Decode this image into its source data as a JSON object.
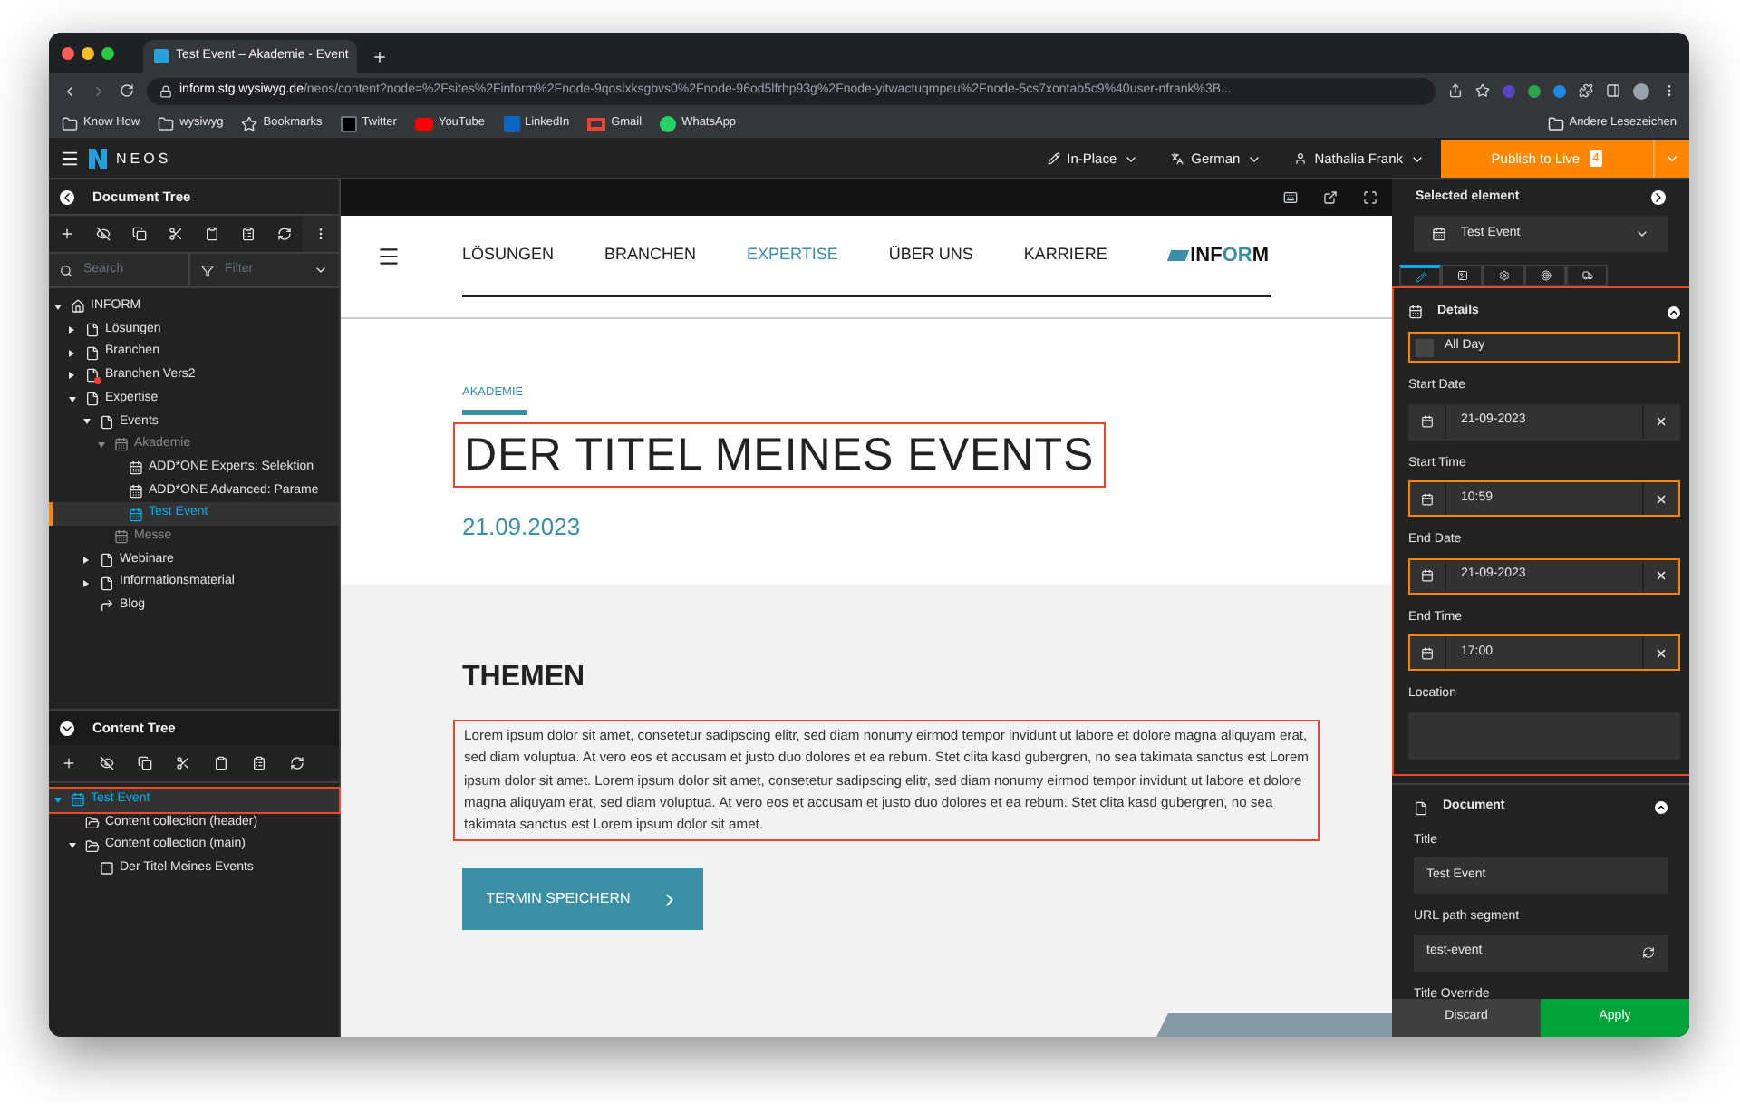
{
  "browser": {
    "tab_title": "Test Event – Akademie - Event",
    "url_host": "inform.stg.wysiwyg.de",
    "url_path": "/neos/content?node=%2Fsites%2Finform%2Fnode-9qoslxksgbvs0%2Fnode-96od5lfrhp93g%2Fnode-yitwactuqmpeu%2Fnode-5cs7xontab5c9%40user-nfrank%3B...",
    "bookmarks": [
      {
        "label": "Know How",
        "kind": "folder"
      },
      {
        "label": "wysiwyg",
        "kind": "folder"
      },
      {
        "label": "Bookmarks",
        "kind": "star"
      },
      {
        "label": "Twitter",
        "kind": "x"
      },
      {
        "label": "YouTube",
        "kind": "youtube"
      },
      {
        "label": "LinkedIn",
        "kind": "linkedin"
      },
      {
        "label": "Gmail",
        "kind": "gmail"
      },
      {
        "label": "WhatsApp",
        "kind": "whatsapp"
      }
    ],
    "other_bookmarks": "Andere Lesezeichen"
  },
  "topbar": {
    "logo": "NEOS",
    "edit_mode": "In-Place",
    "language": "German",
    "user": "Nathalia Frank",
    "publish": "Publish to Live",
    "publish_count": "4"
  },
  "document_tree": {
    "title": "Document Tree",
    "search_placeholder": "Search",
    "filter_placeholder": "Filter",
    "nodes": [
      {
        "label": "INFORM",
        "kind": "home",
        "expanded": true,
        "selected": false,
        "hidden": false,
        "children": [
          {
            "label": "Lösungen",
            "kind": "page",
            "expanded": false,
            "selected": false,
            "hidden": false
          },
          {
            "label": "Branchen",
            "kind": "page",
            "expanded": false,
            "selected": false,
            "hidden": false
          },
          {
            "label": "Branchen Vers2",
            "kind": "page-error",
            "expanded": false,
            "selected": false,
            "hidden": false
          },
          {
            "label": "Expertise",
            "kind": "page",
            "expanded": true,
            "selected": false,
            "hidden": false,
            "children": [
              {
                "label": "Events",
                "kind": "page",
                "expanded": true,
                "selected": false,
                "hidden": false,
                "children": [
                  {
                    "label": "Akademie",
                    "kind": "event",
                    "expanded": true,
                    "selected": false,
                    "hidden": true,
                    "children": [
                      {
                        "label": "ADD*ONE Experts: Selektion",
                        "kind": "event",
                        "selected": false,
                        "hidden": false
                      },
                      {
                        "label": "ADD*ONE Advanced: Parame",
                        "kind": "event",
                        "selected": false,
                        "hidden": false
                      },
                      {
                        "label": "Test Event",
                        "kind": "event",
                        "selected": true,
                        "hidden": false
                      }
                    ]
                  },
                  {
                    "label": "Messe",
                    "kind": "event",
                    "selected": false,
                    "hidden": true
                  }
                ]
              },
              {
                "label": "Webinare",
                "kind": "page",
                "expanded": false,
                "selected": false,
                "hidden": false
              },
              {
                "label": "Informationsmaterial",
                "kind": "page",
                "expanded": false,
                "selected": false,
                "hidden": false
              },
              {
                "label": "Blog",
                "kind": "shortcut",
                "selected": false,
                "hidden": false
              }
            ]
          }
        ]
      }
    ]
  },
  "content_tree": {
    "title": "Content Tree",
    "nodes": [
      {
        "label": "Test Event",
        "kind": "event",
        "expanded": true,
        "selected": true,
        "highlighted": true,
        "children": [
          {
            "label": "Content collection (header)",
            "kind": "collection",
            "selected": false,
            "highlighted": false
          },
          {
            "label": "Content collection (main)",
            "kind": "collection",
            "expanded": true,
            "selected": false,
            "highlighted": false,
            "children": [
              {
                "label": "Der Titel Meines Events",
                "kind": "content",
                "selected": false,
                "highlighted": false
              }
            ]
          }
        ]
      }
    ]
  },
  "page": {
    "nav": [
      {
        "label": "LÖSUNGEN",
        "selected": false
      },
      {
        "label": "BRANCHEN",
        "selected": false
      },
      {
        "label": "EXPERTISE",
        "selected": true
      },
      {
        "label": "ÜBER UNS",
        "selected": false
      },
      {
        "label": "KARRIERE",
        "selected": false
      }
    ],
    "logo": [
      {
        "text": "INF",
        "accent": false
      },
      {
        "text": "OR",
        "accent": true
      },
      {
        "text": "M",
        "accent": false
      }
    ],
    "eyebrow": "AKADEMIE",
    "title": "DER TITEL MEINES EVENTS",
    "title_highlighted": true,
    "date": "21.09.2023",
    "section_title": "THEMEN",
    "body": "Lorem ipsum dolor sit amet, consetetur sadipscing elitr, sed diam nonumy eirmod tempor invidunt ut labore et dolore magna aliquyam erat, sed diam voluptua. At vero eos et accusam et justo duo dolores et ea rebum. Stet clita kasd gubergren, no sea takimata sanctus est Lorem ipsum dolor sit amet. Lorem ipsum dolor sit amet, consetetur sadipscing elitr, sed diam nonumy eirmod tempor invidunt ut labore et dolore magna aliquyam erat, sed diam voluptua. At vero eos et accusam et justo duo dolores et ea rebum. Stet clita kasd gubergren, no sea takimata sanctus est Lorem ipsum dolor sit amet.",
    "body_highlighted": true,
    "button": "TERMIN SPEICHERN"
  },
  "inspector": {
    "title": "Selected element",
    "element": "Test Event",
    "tabs": [
      {
        "selected": true
      },
      {
        "selected": false
      },
      {
        "selected": false
      },
      {
        "selected": false
      },
      {
        "selected": false
      }
    ],
    "details": {
      "title": "Details",
      "highlighted": true,
      "all_day": {
        "label": "All Day",
        "checked": false,
        "modified": true
      },
      "fields": [
        {
          "label": "Start Date",
          "value": "21-09-2023",
          "modified": false
        },
        {
          "label": "Start Time",
          "value": "10:59",
          "modified": true
        },
        {
          "label": "End Date",
          "value": "21-09-2023",
          "modified": true
        },
        {
          "label": "End Time",
          "value": "17:00",
          "modified": true
        }
      ],
      "location_label": "Location"
    },
    "document": {
      "title": "Document",
      "title_label": "Title",
      "title_value": "Test Event",
      "url_label": "URL path segment",
      "url_value": "test-event",
      "override_label": "Title Override"
    },
    "discard": "Discard",
    "apply": "Apply"
  }
}
